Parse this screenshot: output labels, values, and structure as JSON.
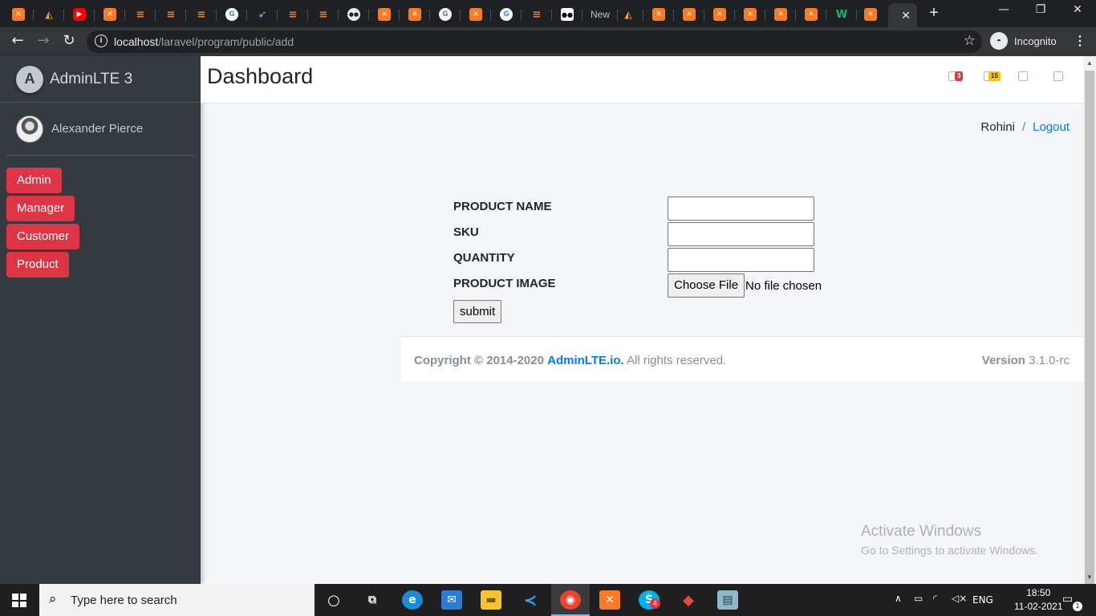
{
  "browser": {
    "new_tab_title": "New",
    "url_host": "localhost",
    "url_path": "/laravel/program/public/add",
    "incognito_label": "Incognito"
  },
  "sidebar": {
    "brand": "AdminLTE 3",
    "brand_logo_letter": "A",
    "user_name": "Alexander Pierce",
    "items": [
      {
        "label": "Admin"
      },
      {
        "label": "Manager"
      },
      {
        "label": "Customer"
      },
      {
        "label": "Product"
      }
    ],
    "button_color": "#dc3545"
  },
  "header": {
    "title": "Dashboard",
    "badges": [
      {
        "value": "3",
        "color": "#dc3545"
      },
      {
        "value": "15",
        "color": "#ffc107"
      }
    ]
  },
  "breadcrumb": {
    "user": "Rohini",
    "separator": "/",
    "logout": "Logout"
  },
  "form": {
    "product_name_label": "PRODUCT NAME",
    "sku_label": "SKU",
    "quantity_label": "QUANTITY",
    "product_image_label": "PRODUCT IMAGE",
    "product_name_value": "",
    "sku_value": "",
    "quantity_value": "",
    "choose_file_label": "Choose File",
    "no_file_text": "No file chosen",
    "submit_label": "submit"
  },
  "footer": {
    "copyright": "Copyright © 2014-2020",
    "brand_link": "AdminLTE.io.",
    "rights": "All rights reserved.",
    "version_label": "Version",
    "version_value": "3.1.0-rc"
  },
  "watermark": {
    "line1": "Activate Windows",
    "line2": "Go to Settings to activate Windows."
  },
  "taskbar": {
    "search_placeholder": "Type here to search",
    "skype_badge": "4",
    "language": "ENG",
    "time": "18:50",
    "date": "11-02-2021",
    "notification_count": "1"
  }
}
